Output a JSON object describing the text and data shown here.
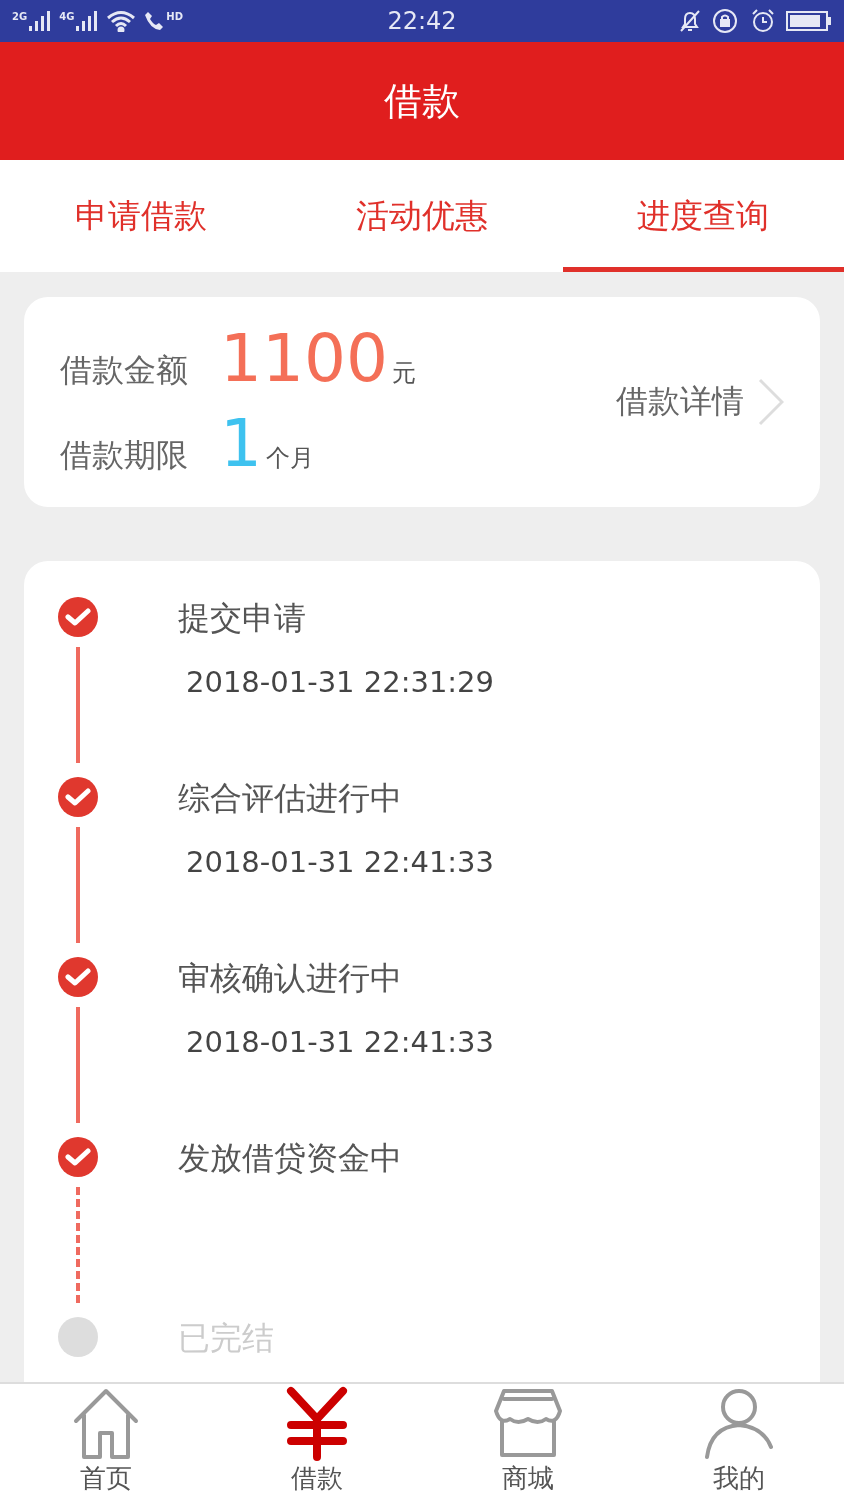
{
  "status_bar": {
    "signals": [
      "2G",
      "4G"
    ],
    "call_label": "HD",
    "time": "22:42"
  },
  "header": {
    "title": "借款"
  },
  "tabs": [
    {
      "label": "申请借款",
      "selected": false
    },
    {
      "label": "活动优惠",
      "selected": false
    },
    {
      "label": "进度查询",
      "selected": true
    }
  ],
  "summary": {
    "amount_label": "借款金额",
    "amount": "1100",
    "amount_unit": "元",
    "term_label": "借款期限",
    "term": "1",
    "term_unit": "个月",
    "details_link": "借款详情"
  },
  "progress": [
    {
      "kind": "solid",
      "title": "提交申请",
      "time": "2018-01-31 22:31:29",
      "done": true
    },
    {
      "kind": "solid",
      "title": "综合评估进行中",
      "time": "2018-01-31 22:41:33",
      "done": true
    },
    {
      "kind": "solid",
      "title": "审核确认进行中",
      "time": "2018-01-31 22:41:33",
      "done": true
    },
    {
      "kind": "dashed",
      "title": "发放借贷资金中",
      "done": true
    },
    {
      "kind": "end",
      "title": "已完结",
      "done": false
    }
  ],
  "bottom_nav": [
    {
      "kind": "home",
      "label": "首页",
      "selected": false
    },
    {
      "kind": "yen",
      "label": "借款",
      "selected": true
    },
    {
      "kind": "shop",
      "label": "商城",
      "selected": false
    },
    {
      "kind": "user",
      "label": "我的",
      "selected": false
    }
  ]
}
